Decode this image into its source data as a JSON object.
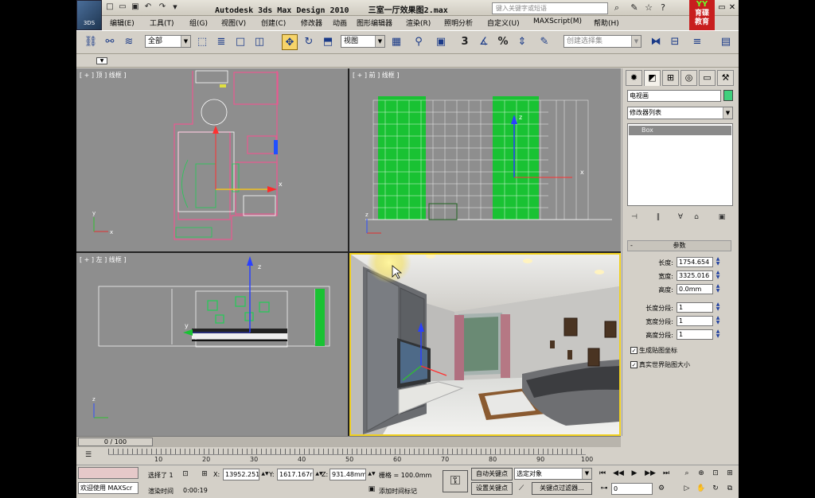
{
  "title": {
    "app": "Autodesk 3ds Max Design 2010",
    "file": "三室一厅效果图2.max",
    "search_placeholder": "键入关键字或短语",
    "brand_top": "YY",
    "brand_lines": [
      "育碟",
      "教育"
    ],
    "logo_text": "3DS"
  },
  "menu": [
    "编辑(E)",
    "工具(T)",
    "组(G)",
    "视图(V)",
    "创建(C)",
    "修改器",
    "动画",
    "图形编辑器",
    "渲染(R)",
    "照明分析",
    "自定义(U)",
    "MAXScript(M)",
    "帮助(H)"
  ],
  "toolbar": {
    "selection_filter": "全部",
    "ref_coord": "视图",
    "named_selection_placeholder": "创建选择集",
    "snap_label": "3",
    "angle_snap_label": "%"
  },
  "viewports": {
    "top_label": "[ + ] 顶 ] 线框 ]",
    "front_label": "[ + ] 前 ] 线框 ]",
    "left_label": "[ + ] 左 ] 线框 ]",
    "axis_x": "x",
    "axis_y": "y",
    "axis_z": "z"
  },
  "command_panel": {
    "object_name": "电视画",
    "object_color": "#3fd07c",
    "modifier_list": "修改器列表",
    "stack_item": "Box",
    "rollout_title": "参数",
    "params": [
      {
        "label": "长度:",
        "value": "1754.654"
      },
      {
        "label": "宽度:",
        "value": "3325.016"
      },
      {
        "label": "高度:",
        "value": "0.0mm"
      },
      {
        "label": "长度分段:",
        "value": "1"
      },
      {
        "label": "宽度分段:",
        "value": "1"
      },
      {
        "label": "高度分段:",
        "value": "1"
      }
    ],
    "checks": [
      {
        "label": "生成贴图坐标",
        "checked": "✓"
      },
      {
        "label": "真实世界贴图大小",
        "checked": "✓"
      }
    ]
  },
  "timeline": {
    "frame": "0 / 100",
    "ticks": [
      "10",
      "20",
      "30",
      "40",
      "50",
      "60",
      "70",
      "80",
      "90",
      "100"
    ]
  },
  "status": {
    "maxscript": "欢迎使用 MAXScr",
    "selected": "选择了 1",
    "x_label": "X:",
    "x": "13952.251",
    "y_label": "Y:",
    "y": "1617.167r",
    "z_label": "Z:",
    "z": "931.48mm",
    "grid": "栅格 = 100.0mm",
    "render_time_label": "渲染时间",
    "render_time": "0:00:19",
    "add_time_tag": "添加时间标记",
    "auto_key": "自动关键点",
    "set_key": "设置关键点",
    "selected_objects": "选定对象",
    "key_filters": "关键点过滤器...",
    "current_frame": "0"
  }
}
